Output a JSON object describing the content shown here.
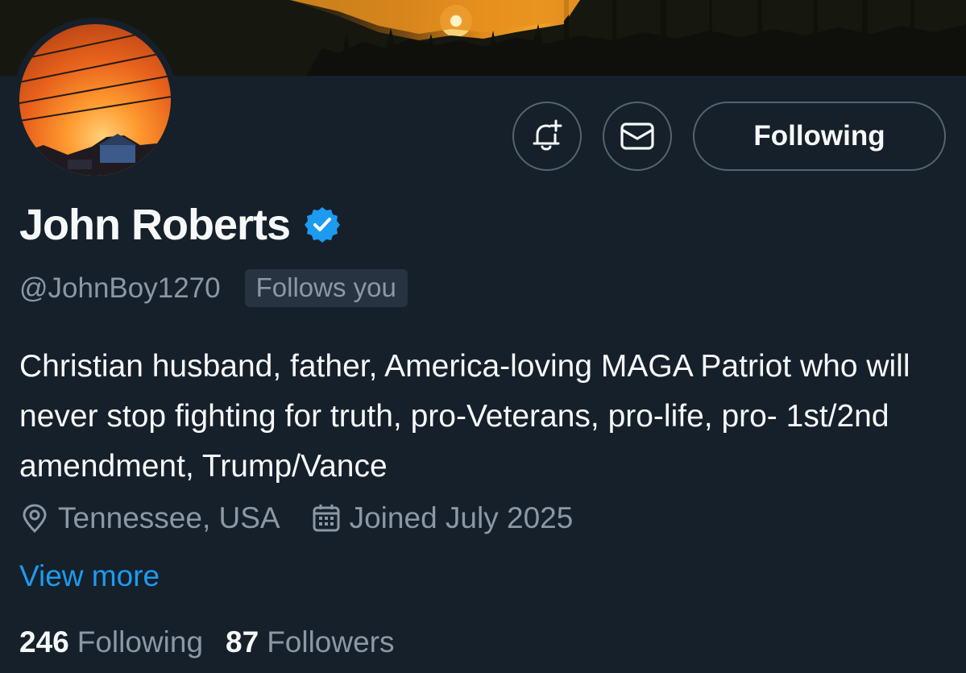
{
  "profile": {
    "display_name": "John Roberts",
    "handle": "@JohnBoy1270",
    "follows_you_badge": "Follows you",
    "bio": "Christian husband, father, America-loving MAGA Patriot who will never stop fighting for truth, pro-Veterans, pro-life, pro- 1st/2nd amendment, Trump/Vance",
    "location": "Tennessee, USA",
    "joined": "Joined July 2025",
    "view_more": "View more",
    "verified_color": "#1d9bf0"
  },
  "actions": {
    "notify_icon": "bell-plus-icon",
    "message_icon": "envelope-icon",
    "follow_label": "Following"
  },
  "stats": {
    "following_count": "246",
    "following_label": "Following",
    "followers_count": "87",
    "followers_label": "Followers"
  },
  "theme": {
    "background": "#15202b",
    "secondary_text": "#8b98a5",
    "link": "#1d9bf0",
    "border": "#536471"
  }
}
